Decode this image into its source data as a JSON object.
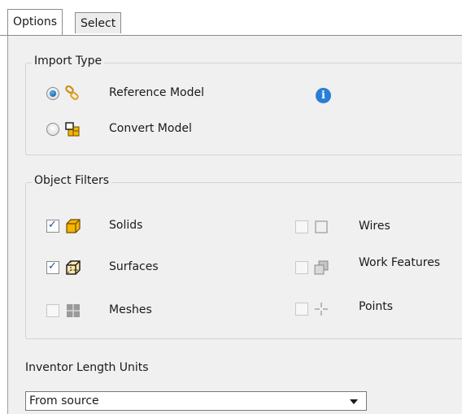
{
  "tabs": [
    {
      "label": "Options",
      "active": true
    },
    {
      "label": "Select",
      "active": false
    }
  ],
  "import_type": {
    "title": "Import Type",
    "options": [
      {
        "label": "Reference Model",
        "selected": true,
        "icon": "chain-link-icon"
      },
      {
        "label": "Convert Model",
        "selected": false,
        "icon": "convert-block-icon"
      }
    ],
    "info_icon": "i"
  },
  "object_filters": {
    "title": "Object Filters",
    "items": [
      {
        "label": "Solids",
        "checked": true,
        "enabled": true,
        "icon": "solid-cube-icon"
      },
      {
        "label": "Surfaces",
        "checked": true,
        "enabled": true,
        "icon": "surface-cube-icon"
      },
      {
        "label": "Meshes",
        "checked": false,
        "enabled": false,
        "icon": "mesh-grid-icon"
      },
      {
        "label": "Wires",
        "checked": false,
        "enabled": false,
        "icon": "wire-square-icon"
      },
      {
        "label": "Work Features",
        "checked": false,
        "enabled": false,
        "icon": "work-plane-icon"
      },
      {
        "label": "Points",
        "checked": false,
        "enabled": false,
        "icon": "point-crosshair-icon"
      }
    ]
  },
  "units": {
    "label": "Inventor Length Units",
    "selected": "From source"
  },
  "colors": {
    "accent": "#2a7ed6",
    "panel": "#f0f0f0",
    "solid_icon": "#f5b400"
  }
}
